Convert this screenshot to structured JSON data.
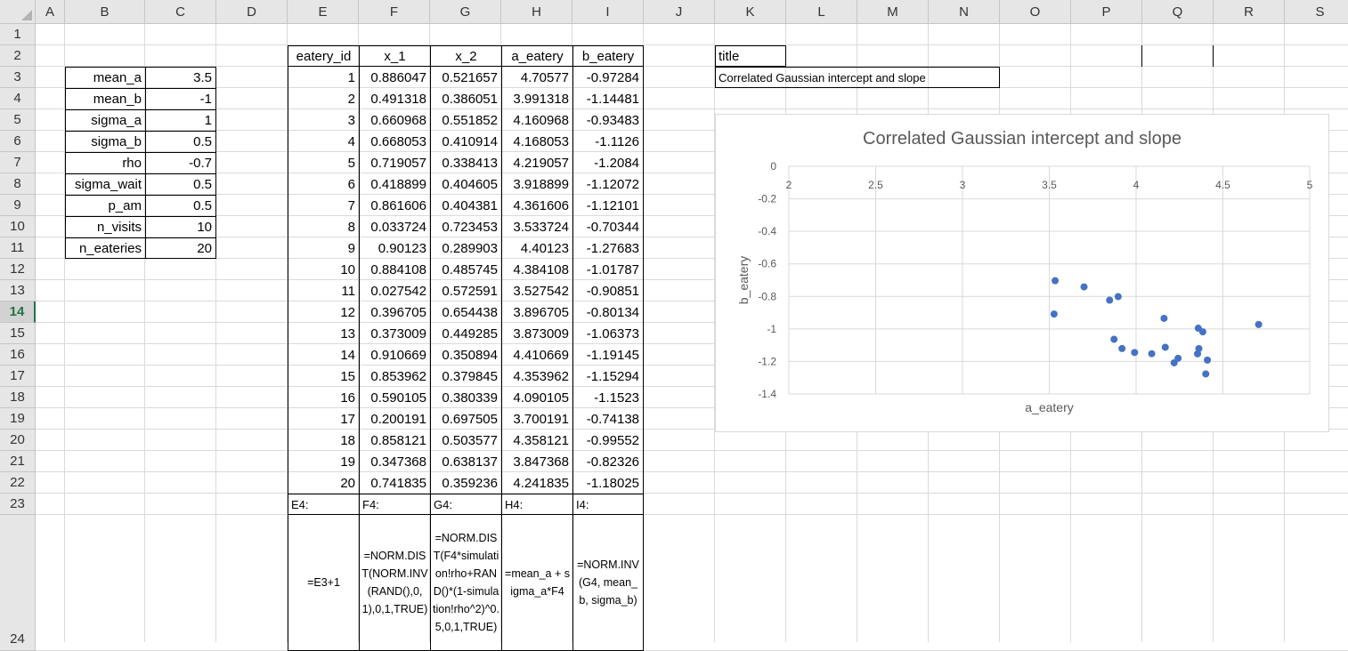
{
  "columns": [
    "A",
    "B",
    "C",
    "D",
    "E",
    "F",
    "G",
    "H",
    "I",
    "J",
    "K",
    "L",
    "M",
    "N",
    "O",
    "P",
    "Q",
    "R",
    "S"
  ],
  "rows": [
    "1",
    "2",
    "3",
    "4",
    "5",
    "6",
    "7",
    "8",
    "9",
    "10",
    "11",
    "12",
    "13",
    "14",
    "15",
    "16",
    "17",
    "18",
    "19",
    "20",
    "21",
    "22",
    "23",
    "24"
  ],
  "active_row": "14",
  "params": [
    {
      "label": "mean_a",
      "value": "3.5"
    },
    {
      "label": "mean_b",
      "value": "-1"
    },
    {
      "label": "sigma_a",
      "value": "1"
    },
    {
      "label": "sigma_b",
      "value": "0.5"
    },
    {
      "label": "rho",
      "value": "-0.7"
    },
    {
      "label": "sigma_wait",
      "value": "0.5"
    },
    {
      "label": "p_am",
      "value": "0.5"
    },
    {
      "label": "n_visits",
      "value": "10"
    },
    {
      "label": "n_eateries",
      "value": "20"
    }
  ],
  "table_headers": [
    "eatery_id",
    "x_1",
    "x_2",
    "a_eatery",
    "b_eatery"
  ],
  "table_rows": [
    [
      "1",
      "0.886047",
      "0.521657",
      "4.70577",
      "-0.97284"
    ],
    [
      "2",
      "0.491318",
      "0.386051",
      "3.991318",
      "-1.14481"
    ],
    [
      "3",
      "0.660968",
      "0.551852",
      "4.160968",
      "-0.93483"
    ],
    [
      "4",
      "0.668053",
      "0.410914",
      "4.168053",
      "-1.1126"
    ],
    [
      "5",
      "0.719057",
      "0.338413",
      "4.219057",
      "-1.2084"
    ],
    [
      "6",
      "0.418899",
      "0.404605",
      "3.918899",
      "-1.12072"
    ],
    [
      "7",
      "0.861606",
      "0.404381",
      "4.361606",
      "-1.12101"
    ],
    [
      "8",
      "0.033724",
      "0.723453",
      "3.533724",
      "-0.70344"
    ],
    [
      "9",
      "0.90123",
      "0.289903",
      "4.40123",
      "-1.27683"
    ],
    [
      "10",
      "0.884108",
      "0.485745",
      "4.384108",
      "-1.01787"
    ],
    [
      "11",
      "0.027542",
      "0.572591",
      "3.527542",
      "-0.90851"
    ],
    [
      "12",
      "0.396705",
      "0.654438",
      "3.896705",
      "-0.80134"
    ],
    [
      "13",
      "0.373009",
      "0.449285",
      "3.873009",
      "-1.06373"
    ],
    [
      "14",
      "0.910669",
      "0.350894",
      "4.410669",
      "-1.19145"
    ],
    [
      "15",
      "0.853962",
      "0.379845",
      "4.353962",
      "-1.15294"
    ],
    [
      "16",
      "0.590105",
      "0.380339",
      "4.090105",
      "-1.1523"
    ],
    [
      "17",
      "0.200191",
      "0.697505",
      "3.700191",
      "-0.74138"
    ],
    [
      "18",
      "0.858121",
      "0.503577",
      "4.358121",
      "-0.99552"
    ],
    [
      "19",
      "0.347368",
      "0.638137",
      "3.847368",
      "-0.82326"
    ],
    [
      "20",
      "0.741835",
      "0.359236",
      "4.241835",
      "-1.18025"
    ]
  ],
  "formula_labels": [
    "E4:",
    "F4:",
    "G4:",
    "H4:",
    "I4:"
  ],
  "formulas": [
    "=E3+1",
    "=NORM.DIST(NORM.INV(RAND(),0,1),0,1,TRUE)",
    "=NORM.DIST(F4*simulation!rho+RAND()*(1-simulation!rho^2)^0.5,0,1,TRUE)",
    "=mean_a + sigma_a*F4",
    "=NORM.INV(G4, mean_b, sigma_b)"
  ],
  "title_label": "title",
  "title_value": "Correlated Gaussian intercept and slope",
  "chart_data": {
    "type": "scatter",
    "title": "Correlated Gaussian intercept and slope",
    "xlabel": "a_eatery",
    "ylabel": "b_eatery",
    "xlim": [
      2,
      5
    ],
    "ylim": [
      -1.4,
      0
    ],
    "xticks": [
      "2",
      "2.5",
      "3",
      "3.5",
      "4",
      "4.5",
      "5"
    ],
    "yticks": [
      "0",
      "-0.2",
      "-0.4",
      "-0.6",
      "-0.8",
      "-1",
      "-1.2",
      "-1.4"
    ],
    "grid": true,
    "marker_color": "#4472c4",
    "x": [
      4.70577,
      3.991318,
      4.160968,
      4.168053,
      4.219057,
      3.918899,
      4.361606,
      3.533724,
      4.40123,
      4.384108,
      3.527542,
      3.896705,
      3.873009,
      4.410669,
      4.353962,
      4.090105,
      3.700191,
      4.358121,
      3.847368,
      4.241835
    ],
    "y": [
      -0.97284,
      -1.14481,
      -0.93483,
      -1.1126,
      -1.2084,
      -1.12072,
      -1.12101,
      -0.70344,
      -1.27683,
      -1.01787,
      -0.90851,
      -0.80134,
      -1.06373,
      -1.19145,
      -1.15294,
      -1.1523,
      -0.74138,
      -0.99552,
      -0.82326,
      -1.18025
    ]
  }
}
